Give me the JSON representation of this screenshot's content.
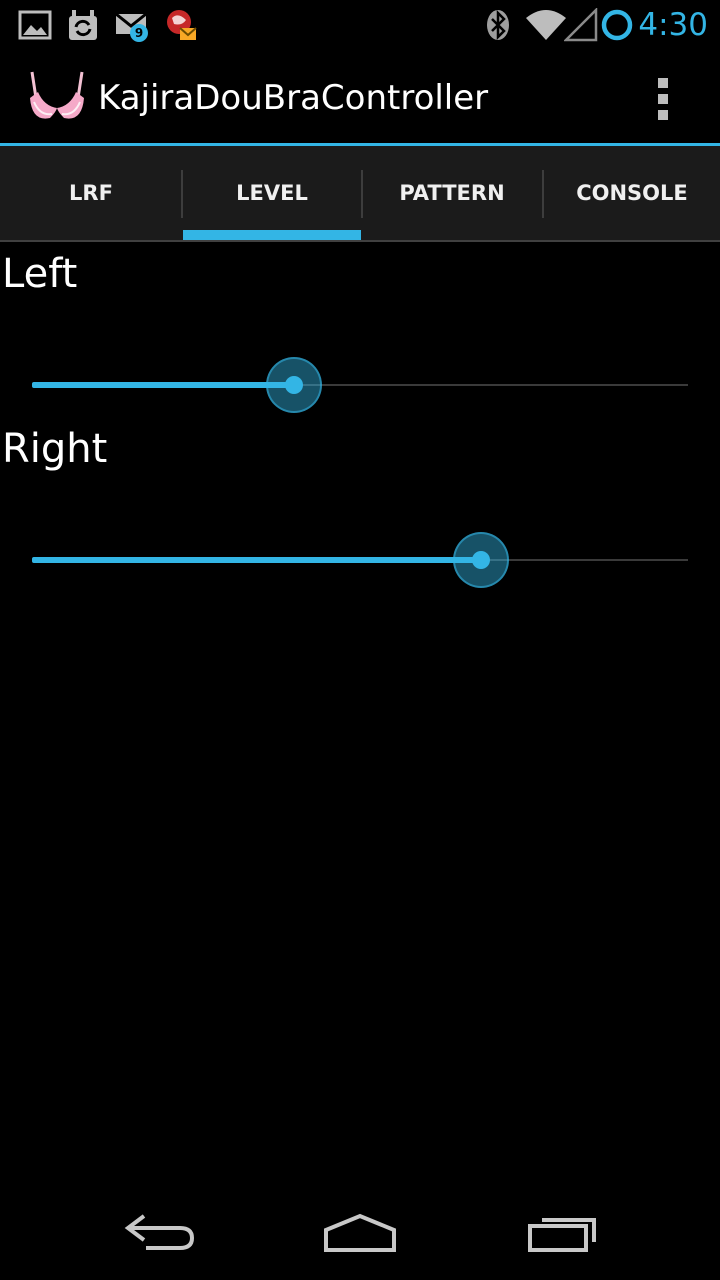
{
  "status_bar": {
    "time": "4:30",
    "notification_icons": [
      "gallery-icon",
      "sync-icon",
      "email-icon",
      "maps-icon"
    ],
    "email_badge_count": "9",
    "system_icons": [
      "bluetooth-icon",
      "wifi-icon",
      "cell-signal-icon",
      "battery-icon"
    ]
  },
  "action_bar": {
    "title": "KajiraDouBraController",
    "logo_icon": "bra-icon",
    "menu_icon": "overflow-menu-icon"
  },
  "tabs": [
    {
      "label": "LRF",
      "selected": false
    },
    {
      "label": "LEVEL",
      "selected": true
    },
    {
      "label": "PATTERN",
      "selected": false
    },
    {
      "label": "CONSOLE",
      "selected": false
    }
  ],
  "sliders": [
    {
      "label": "Left",
      "value_fraction": 0.4
    },
    {
      "label": "Right",
      "value_fraction": 0.685
    }
  ],
  "navigation": {
    "back_icon": "back-icon",
    "home_icon": "home-icon",
    "recents_icon": "recent-apps-icon"
  },
  "colors": {
    "accent": "#33b5e5",
    "background": "#000000",
    "tab_background": "#1b1b1b"
  }
}
